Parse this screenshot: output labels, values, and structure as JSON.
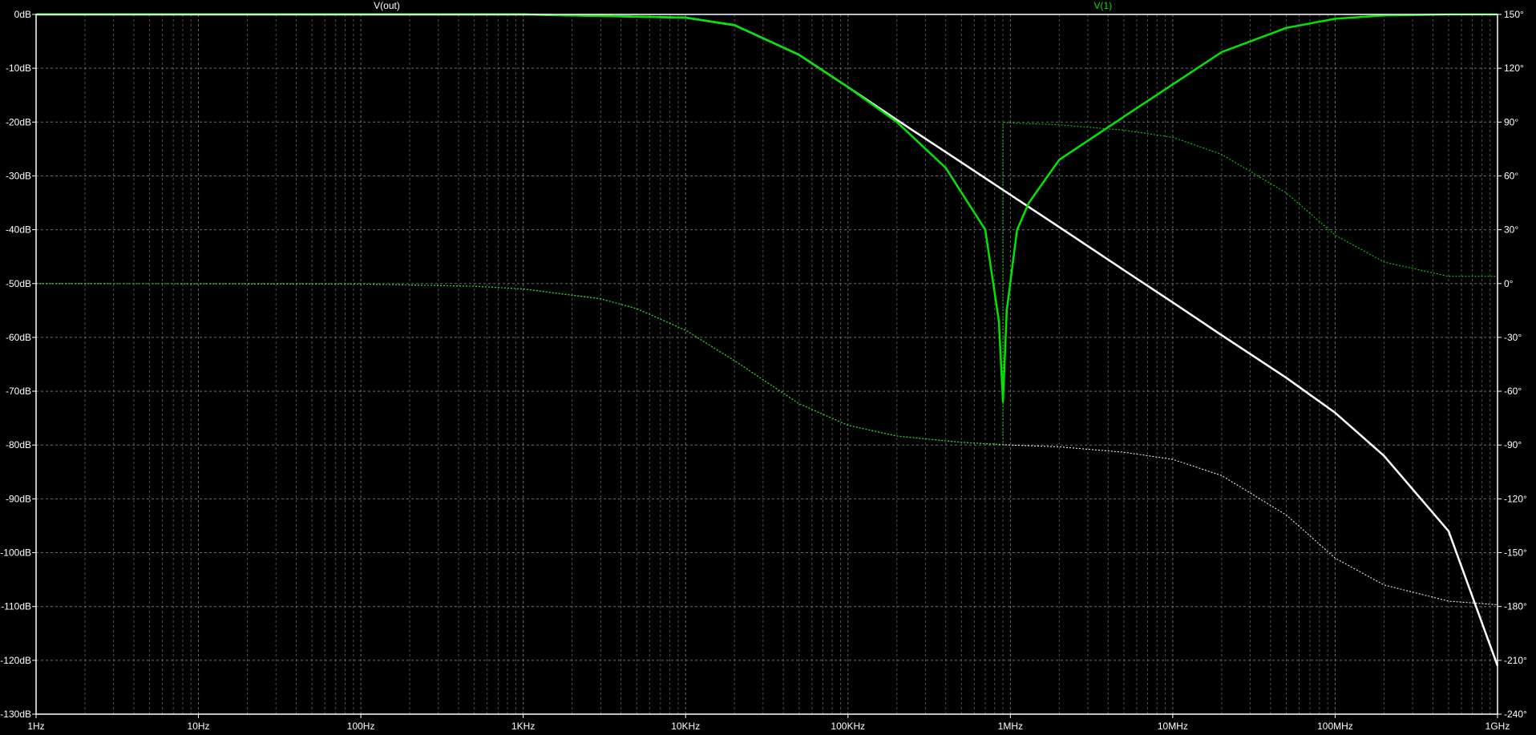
{
  "window": {
    "background": "#000000",
    "axis_color": "#ffffff",
    "grid_color": "#7a7a7a"
  },
  "chart_data": {
    "type": "line",
    "x_scale": "log",
    "x_unit": "Hz",
    "xlim": [
      1,
      1000000000
    ],
    "x_ticks": [
      {
        "value": 1,
        "label": "1Hz"
      },
      {
        "value": 10,
        "label": "10Hz"
      },
      {
        "value": 100,
        "label": "100Hz"
      },
      {
        "value": 1000,
        "label": "1KHz"
      },
      {
        "value": 10000,
        "label": "10KHz"
      },
      {
        "value": 100000,
        "label": "100KHz"
      },
      {
        "value": 1000000,
        "label": "1MHz"
      },
      {
        "value": 10000000,
        "label": "10MHz"
      },
      {
        "value": 100000000,
        "label": "100MHz"
      },
      {
        "value": 1000000000,
        "label": "1GHz"
      }
    ],
    "y_left": {
      "unit": "dB",
      "lim": [
        -130,
        0
      ],
      "ticks": [
        {
          "value": 0,
          "label": "0dB"
        },
        {
          "value": -10,
          "label": "-10dB"
        },
        {
          "value": -20,
          "label": "-20dB"
        },
        {
          "value": -30,
          "label": "-30dB"
        },
        {
          "value": -40,
          "label": "-40dB"
        },
        {
          "value": -50,
          "label": "-50dB"
        },
        {
          "value": -60,
          "label": "-60dB"
        },
        {
          "value": -70,
          "label": "-70dB"
        },
        {
          "value": -80,
          "label": "-80dB"
        },
        {
          "value": -90,
          "label": "-90dB"
        },
        {
          "value": -100,
          "label": "-100dB"
        },
        {
          "value": -110,
          "label": "-110dB"
        },
        {
          "value": -120,
          "label": "-120dB"
        },
        {
          "value": -130,
          "label": "-130dB"
        }
      ]
    },
    "y_right": {
      "unit": "deg",
      "lim": [
        -240,
        150
      ],
      "ticks": [
        {
          "value": 150,
          "label": "150°"
        },
        {
          "value": 120,
          "label": "120°"
        },
        {
          "value": 90,
          "label": "90°"
        },
        {
          "value": 60,
          "label": "60°"
        },
        {
          "value": 30,
          "label": "30°"
        },
        {
          "value": 0,
          "label": "0°"
        },
        {
          "value": -30,
          "label": "-30°"
        },
        {
          "value": -60,
          "label": "-60°"
        },
        {
          "value": -90,
          "label": "-90°"
        },
        {
          "value": -120,
          "label": "-120°"
        },
        {
          "value": -150,
          "label": "-150°"
        },
        {
          "value": -180,
          "label": "-180°"
        },
        {
          "value": -210,
          "label": "-210°"
        },
        {
          "value": -240,
          "label": "-240°"
        }
      ]
    },
    "grid": true,
    "series": [
      {
        "name": "V(out)",
        "color": "#ffffff",
        "magnitude_db": {
          "x": [
            1,
            1000,
            10000,
            20000,
            50000,
            100000,
            200000,
            500000,
            1000000,
            2000000,
            5000000,
            10000000,
            20000000,
            50000000,
            100000000,
            200000000,
            500000000,
            1000000000
          ],
          "y": [
            0,
            0,
            -0.6,
            -2.0,
            -7.5,
            -13.5,
            -19.6,
            -27.5,
            -33.5,
            -39.5,
            -47.5,
            -53.5,
            -59.6,
            -67.5,
            -74.0,
            -82.0,
            -96.0,
            -121.0
          ]
        },
        "phase_deg": {
          "x": [
            1,
            100,
            500,
            1000,
            3000,
            5000,
            10000,
            20000,
            50000,
            100000,
            200000,
            500000,
            1000000,
            2000000,
            5000000,
            10000000,
            20000000,
            50000000,
            100000000,
            200000000,
            500000000,
            1000000000
          ],
          "y": [
            0,
            -0.3,
            -1.5,
            -3,
            -8.5,
            -14,
            -26,
            -43,
            -67,
            -79,
            -85,
            -88.5,
            -90,
            -91,
            -94,
            -98,
            -107,
            -129,
            -153,
            -168,
            -177,
            -179
          ]
        }
      },
      {
        "name": "V(1)",
        "color": "#00e600",
        "magnitude_db": {
          "x": [
            1,
            1000,
            10000,
            20000,
            50000,
            100000,
            200000,
            400000,
            700000,
            850000,
            900000,
            950000,
            1100000,
            1300000,
            2000000,
            5000000,
            10000000,
            20000000,
            50000000,
            100000000,
            200000000,
            500000000,
            1000000000
          ],
          "y": [
            0,
            0,
            -0.6,
            -2.0,
            -7.5,
            -13.5,
            -20.0,
            -28.5,
            -40.0,
            -57.0,
            -72.0,
            -55.0,
            -40.0,
            -35.0,
            -27.0,
            -19.0,
            -13.0,
            -7.0,
            -2.5,
            -0.8,
            -0.2,
            0,
            0
          ]
        },
        "phase_deg": {
          "x": [
            1,
            100,
            500,
            1000,
            3000,
            5000,
            10000,
            20000,
            50000,
            100000,
            200000,
            500000,
            899999,
            900001,
            1000000,
            2000000,
            5000000,
            10000000,
            20000000,
            50000000,
            100000000,
            200000000,
            500000000,
            1000000000
          ],
          "y": [
            0,
            -0.3,
            -1.5,
            -3,
            -8.5,
            -14,
            -26,
            -43,
            -67,
            -79,
            -85,
            -88.5,
            -89.9,
            89.9,
            89.5,
            88.5,
            85.5,
            81.5,
            72,
            50.5,
            27,
            12,
            4,
            4
          ]
        }
      }
    ]
  }
}
